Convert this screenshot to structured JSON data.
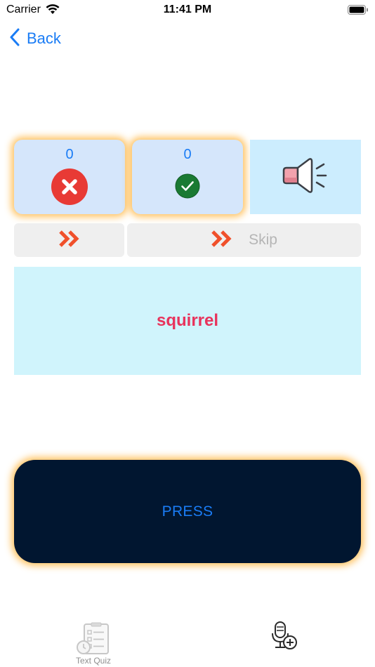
{
  "status_bar": {
    "carrier": "Carrier",
    "time": "11:41 PM"
  },
  "nav": {
    "back_label": "Back"
  },
  "scores": {
    "wrong_count": "0",
    "right_count": "0",
    "colors": {
      "wrong": "#e83a35",
      "right": "#1a7a33",
      "count": "#1a7cf5"
    }
  },
  "controls": {
    "skip_label": "Skip",
    "press_label": "PRESS"
  },
  "quiz": {
    "word": "squirrel"
  },
  "tab_bar": {
    "items": [
      {
        "label": "Text Quiz",
        "icon": "quiz-sheet-icon"
      },
      {
        "label": "",
        "icon": "mic-add-icon"
      }
    ]
  },
  "theme": {
    "accent": "#1a7cf5",
    "word_color": "#e8335c",
    "glow": "#ffaf2d",
    "press_bg": "#011630",
    "card_bg": "#d0f4fc"
  }
}
